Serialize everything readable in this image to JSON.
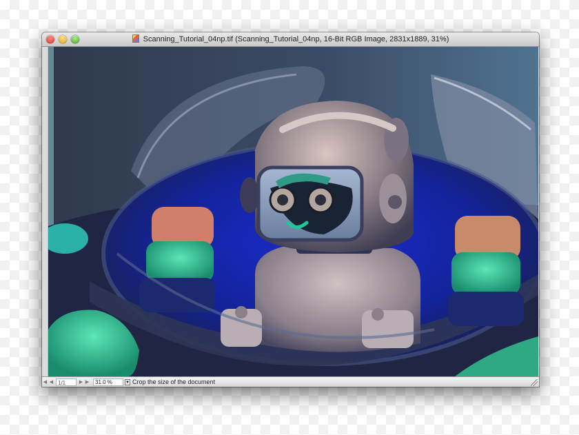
{
  "window": {
    "title": "Scanning_Tutorial_04np.tif (Scanning_Tutorial_04np, 16-Bit RGB Image, 2831x1889, 31%)",
    "icon": "photoshop-document-icon"
  },
  "canvas": {
    "subject": "inverted-color photo of a toy robot in a space capsule"
  },
  "statusbar": {
    "page": "1/1",
    "zoom": "31.0 %",
    "status_text": "Crop the size of the document"
  },
  "colors": {
    "close": "#d6312a",
    "minimize": "#d9a016",
    "zoom": "#3f9e23"
  }
}
